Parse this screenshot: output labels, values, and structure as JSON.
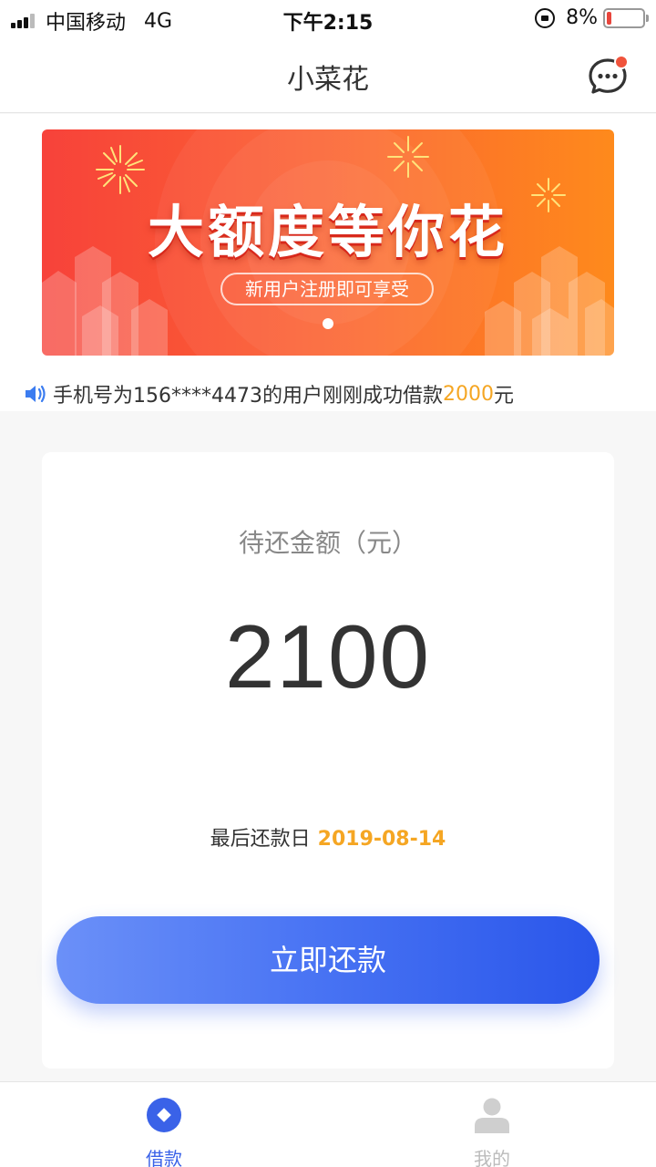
{
  "status_bar": {
    "carrier": "中国移动",
    "network": "4G",
    "time": "下午2:15",
    "battery_percent": "8%",
    "battery_level": 0.08
  },
  "header": {
    "title": "小菜花",
    "message_icon": "chat-bubble-icon",
    "has_unread": true
  },
  "banner": {
    "title": "大额度等你花",
    "subtitle": "新用户注册即可享受",
    "slide_count": 1,
    "active_slide": 1
  },
  "notice": {
    "prefix": "手机号为156****4473的用户刚刚成功借款",
    "amount": "2000",
    "suffix": "元"
  },
  "repayment_card": {
    "label": "待还金额（元）",
    "amount": "2100",
    "due_label": "最后还款日",
    "due_date": "2019-08-14",
    "button_label": "立即还款"
  },
  "tab_bar": {
    "tabs": [
      {
        "label": "借款",
        "icon": "loan-icon",
        "active": true
      },
      {
        "label": "我的",
        "icon": "user-icon",
        "active": false
      }
    ]
  },
  "colors": {
    "primary": "#3a62e8",
    "accent": "#f5a623",
    "banner_start": "#f7423a",
    "banner_end": "#fe8a1c",
    "badge": "#f0533b"
  }
}
